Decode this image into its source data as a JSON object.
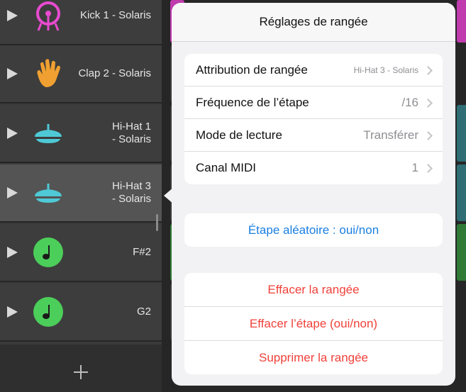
{
  "tracks": [
    {
      "name": "Kick 1 - Solaris",
      "icon": "kick-drum-icon",
      "color": "#e84bd0"
    },
    {
      "name": "Clap 2 - Solaris",
      "icon": "hand-clap-icon",
      "color": "#f0a030"
    },
    {
      "name": "Hi-Hat 1\n- Solaris",
      "icon": "hi-hat-icon",
      "color": "#4fc9d6"
    },
    {
      "name": "Hi-Hat 3\n- Solaris",
      "icon": "hi-hat-icon",
      "color": "#4fc9d6"
    },
    {
      "name": "F#2",
      "icon": "music-note-icon",
      "color": "#4cce5a"
    },
    {
      "name": "G2",
      "icon": "music-note-icon",
      "color": "#4cce5a"
    }
  ],
  "popover": {
    "title": "Réglages de rangée",
    "settings": [
      {
        "label": "Attribution de rangée",
        "value": "Hi-Hat 3 - Solaris"
      },
      {
        "label": "Fréquence de l’étape",
        "value": "/16"
      },
      {
        "label": "Mode de lecture",
        "value": "Transférer"
      },
      {
        "label": "Canal MIDI",
        "value": "1"
      }
    ],
    "random_step": "Étape aléatoire : oui/non",
    "actions": [
      "Effacer la rangée",
      "Effacer l’étape (oui/non)",
      "Supprimer la rangée"
    ]
  }
}
